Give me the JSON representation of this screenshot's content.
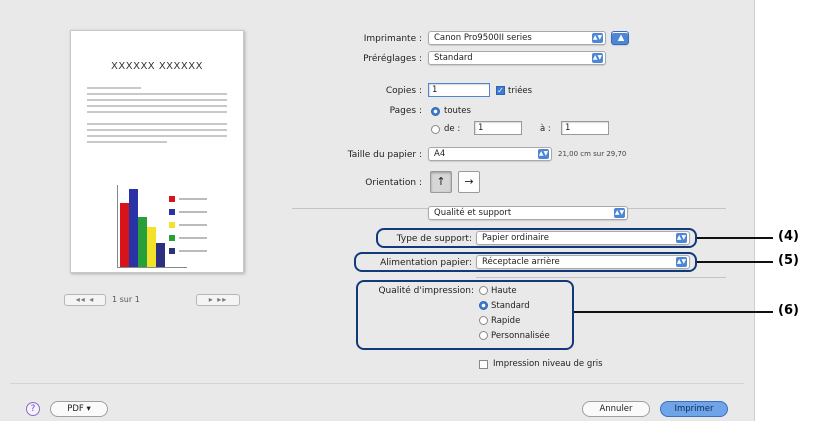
{
  "preview": {
    "page_title": "XXXXXX XXXXXX",
    "pager_first": "◂◂  ◂",
    "pager_text": "1 sur 1",
    "pager_last": "▸  ▸▸"
  },
  "printer": {
    "label": "Imprimante :",
    "value": "Canon Pro9500II series"
  },
  "presets": {
    "label": "Préréglages :",
    "value": "Standard"
  },
  "copies": {
    "label": "Copies :",
    "value": "1",
    "collated_label": "triées",
    "collated": true
  },
  "pages": {
    "label": "Pages :",
    "all_label": "toutes",
    "from_label": "de :",
    "from_value": "1",
    "to_label": "à :",
    "to_value": "1"
  },
  "paper_size": {
    "label": "Taille du papier :",
    "value": "A4",
    "dimensions": "21,00 cm sur 29,70"
  },
  "orientation": {
    "label": "Orientation :"
  },
  "panel_select": {
    "value": "Qualité et support"
  },
  "media_type": {
    "label": "Type de support:",
    "value": "Papier ordinaire"
  },
  "paper_source": {
    "label": "Alimentation papier:",
    "value": "Réceptacle arrière"
  },
  "print_quality": {
    "label": "Qualité d'impression:",
    "options": [
      "Haute",
      "Standard",
      "Rapide",
      "Personnalisée"
    ],
    "selected": "Standard"
  },
  "grayscale": {
    "label": "Impression niveau de gris",
    "checked": false
  },
  "footer": {
    "help": "?",
    "pdf": "PDF ▾",
    "cancel": "Annuler",
    "print": "Imprimer"
  },
  "callouts": [
    "(4)",
    "(5)",
    "(6)"
  ],
  "colors": {
    "highlight": "#123a7a",
    "accent": "#3d7bd4"
  }
}
